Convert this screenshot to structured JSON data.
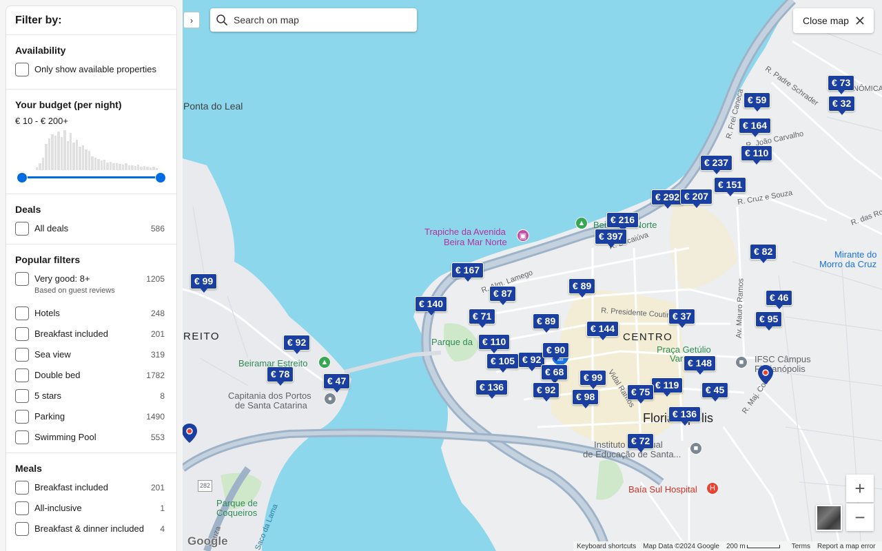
{
  "filters": {
    "title": "Filter by:",
    "availability": {
      "title": "Availability",
      "option": "Only show available properties"
    },
    "budget": {
      "title": "Your budget (per night)",
      "range": "€ 10 - € 200+",
      "histogram": [
        4,
        10,
        18,
        38,
        46,
        52,
        50,
        56,
        48,
        58,
        42,
        54,
        40,
        44,
        34,
        36,
        30,
        28,
        20,
        18,
        16,
        14,
        15,
        11,
        12,
        10,
        10,
        9,
        8,
        10,
        7,
        7,
        6,
        8,
        5,
        6,
        5,
        4,
        5,
        3
      ]
    },
    "deals": {
      "title": "Deals",
      "items": [
        {
          "label": "All deals",
          "count": "586"
        }
      ]
    },
    "popular": {
      "title": "Popular filters",
      "items": [
        {
          "label": "Very good: 8+",
          "sub": "Based on guest reviews",
          "count": "1205"
        },
        {
          "label": "Hotels",
          "count": "248"
        },
        {
          "label": "Breakfast included",
          "count": "201"
        },
        {
          "label": "Sea view",
          "count": "319"
        },
        {
          "label": "Double bed",
          "count": "1782"
        },
        {
          "label": "5 stars",
          "count": "8"
        },
        {
          "label": "Parking",
          "count": "1490"
        },
        {
          "label": "Swimming Pool",
          "count": "553"
        }
      ]
    },
    "meals": {
      "title": "Meals",
      "items": [
        {
          "label": "Breakfast included",
          "count": "201"
        },
        {
          "label": "All-inclusive",
          "count": "1"
        },
        {
          "label": "Breakfast & dinner included",
          "count": "4"
        }
      ]
    }
  },
  "map": {
    "search_placeholder": "Search on map",
    "close_label": "Close map",
    "collapse_icon": "chevron-right-icon",
    "zoom_in": "+",
    "zoom_out": "−",
    "google": "Google",
    "footer": {
      "shortcuts": "Keyboard shortcuts",
      "map_data": "Map Data ©2024 Google",
      "scale": "200 m",
      "terms": "Terms",
      "report": "Report a map error"
    },
    "labels": {
      "ponta_do_leal": "Ponta do Leal",
      "trapiche_1": "Trapiche da Avenida",
      "trapiche_2": "Beira Mar Norte",
      "beira_mar_norte": "Beira-Mar Norte",
      "parque_da": "Parque da",
      "beiramar_estreito": "Beiramar Estreito",
      "capitania_1": "Capitania dos Portos",
      "capitania_2": "de Santa Catarina",
      "reito": "REITO",
      "centro": "CENTRO",
      "florianopolis": "Florianópolis",
      "praca_1": "Praça Getúlio",
      "praca_2": "Var",
      "ifsc_1": "IFSC Câmpus",
      "ifsc_2": "Florianópolis",
      "instituto_1": "Instituto Estadual",
      "instituto_2": "de Educação de Santa...",
      "baia_sul": "Baía Sul Hospital",
      "parque_coqueiros_1": "Parque de",
      "parque_coqueiros_2": "Coqueiros",
      "saco_da_lama": "Saco da Lama",
      "mirante_1": "Mirante do",
      "mirante_2": "Morro da Cruz",
      "nomica": "NÔMICA",
      "r_padre_schrader": "R. Padre Schrader",
      "r_joao_carvalho": "R. João Carvalho",
      "r_frei_caneca": "R. Frei Caneca",
      "r_cruz_e_souza": "R. Cruz e Souza",
      "r_das_ros": "R. das Ros",
      "r_bocaiuva": "R. Bocaiúva",
      "r_alm_lamego": "R. Alm. Lamego",
      "r_presidente_coutinho": "R. Presidente Coutinho",
      "av_mauro_ramos": "Av. Mauro Ramos",
      "r_maj_costa": "R. Maj. Costa",
      "vidal_ramos": "Vidal Ramos",
      "route_282": "282",
      "souza": "Souza"
    },
    "pins": [
      "€ 73",
      "€ 32",
      "€ 59",
      "€ 164",
      "€ 110",
      "€ 237",
      "€ 151",
      "€ 292",
      "€ 207",
      "€ 216",
      "€ 397",
      "€ 82",
      "€ 167",
      "€ 89",
      "€ 87",
      "€ 140",
      "€ 46",
      "€ 71",
      "€ 89",
      "€ 37",
      "€ 95",
      "€ 144",
      "€ 110",
      "€ 92",
      "€ 92",
      "€ 105",
      "€ 148",
      "€ 68",
      "€ 99",
      "€ 136",
      "€ 119",
      "€ 92",
      "€ 75",
      "€ 98",
      "€ 45",
      "€ 136",
      "€ 78",
      "€ 47",
      "€ 99",
      "€ 72",
      "€ 90"
    ]
  }
}
